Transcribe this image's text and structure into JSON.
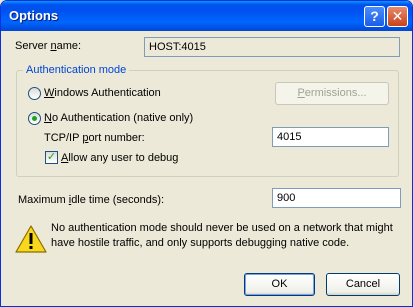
{
  "window": {
    "title": "Options",
    "help_glyph": "?",
    "close_glyph": "✕"
  },
  "server": {
    "label_pre": "Server ",
    "label_accel": "n",
    "label_post": "ame:",
    "value": "HOST:4015"
  },
  "auth": {
    "caption": "Authentication mode",
    "windows": {
      "accel": "W",
      "rest": "indows Authentication",
      "selected": false
    },
    "permissions": {
      "accel": "P",
      "rest": "ermissions..."
    },
    "none": {
      "accel": "N",
      "rest": "o Authentication (native only)",
      "selected": true
    },
    "port": {
      "label_pre": "TCP/IP ",
      "label_accel": "p",
      "label_post": "ort number:",
      "value": "4015"
    },
    "allow_debug": {
      "accel": "A",
      "rest": "llow any user to debug",
      "checked": true
    }
  },
  "idle": {
    "label_pre": "Maximum ",
    "label_accel": "i",
    "label_post": "dle time (seconds):",
    "value": "900"
  },
  "warning": {
    "icon": "warning-icon",
    "text": "No authentication mode should never be used on a network that might have hostile traffic, and only supports debugging native code."
  },
  "buttons": {
    "ok": "OK",
    "cancel": "Cancel"
  },
  "colors": {
    "titlebar": "#0053ee",
    "face": "#ece9d8",
    "group_caption": "#0046d5",
    "check_green": "#21a121",
    "warning_yellow": "#f8d81c"
  }
}
